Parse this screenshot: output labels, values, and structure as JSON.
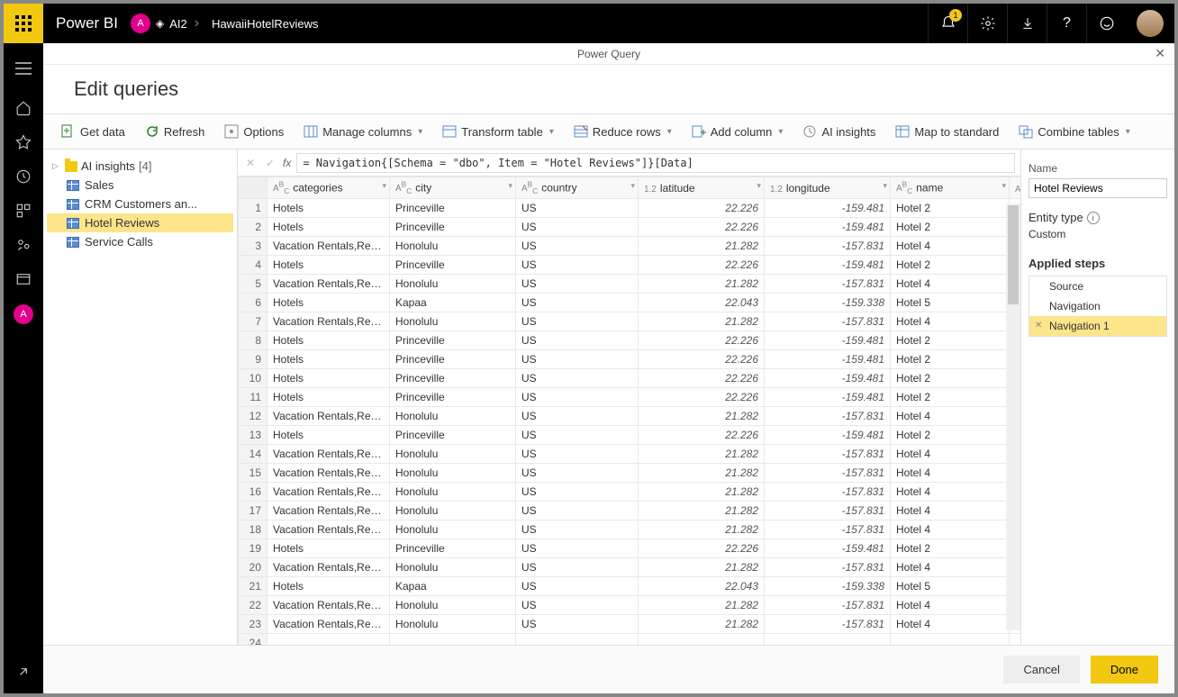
{
  "topbar": {
    "brand": "Power BI",
    "avatarLetter": "A",
    "workspace": "AI2",
    "breadcrumbItem": "HawaiiHotelReviews",
    "notificationCount": "1"
  },
  "pq": {
    "windowTitle": "Power Query",
    "pageTitle": "Edit queries"
  },
  "ribbon": {
    "getData": "Get data",
    "refresh": "Refresh",
    "options": "Options",
    "manageColumns": "Manage columns",
    "transformTable": "Transform table",
    "reduceRows": "Reduce rows",
    "addColumn": "Add column",
    "aiInsights": "AI insights",
    "mapStd": "Map to standard",
    "combineTables": "Combine tables"
  },
  "queriesPane": {
    "folder": "AI insights",
    "folderCount": "[4]",
    "items": [
      "Sales",
      "CRM Customers an...",
      "Hotel Reviews",
      "Service Calls"
    ],
    "selectedIndex": 2
  },
  "formulaBar": {
    "formula": "= Navigation{[Schema = \"dbo\", Item = \"Hotel Reviews\"]}[Data]"
  },
  "table": {
    "columns": [
      {
        "type": "ABC",
        "name": "categories"
      },
      {
        "type": "ABC",
        "name": "city"
      },
      {
        "type": "ABC",
        "name": "country"
      },
      {
        "type": "1.2",
        "name": "latitude"
      },
      {
        "type": "1.2",
        "name": "longitude"
      },
      {
        "type": "ABC",
        "name": "name"
      }
    ],
    "rows": [
      [
        "Hotels",
        "Princeville",
        "US",
        "22.226",
        "-159.481",
        "Hotel 2"
      ],
      [
        "Hotels",
        "Princeville",
        "US",
        "22.226",
        "-159.481",
        "Hotel 2"
      ],
      [
        "Vacation Rentals,Resorts &...",
        "Honolulu",
        "US",
        "21.282",
        "-157.831",
        "Hotel 4"
      ],
      [
        "Hotels",
        "Princeville",
        "US",
        "22.226",
        "-159.481",
        "Hotel 2"
      ],
      [
        "Vacation Rentals,Resorts &...",
        "Honolulu",
        "US",
        "21.282",
        "-157.831",
        "Hotel 4"
      ],
      [
        "Hotels",
        "Kapaa",
        "US",
        "22.043",
        "-159.338",
        "Hotel 5"
      ],
      [
        "Vacation Rentals,Resorts &...",
        "Honolulu",
        "US",
        "21.282",
        "-157.831",
        "Hotel 4"
      ],
      [
        "Hotels",
        "Princeville",
        "US",
        "22.226",
        "-159.481",
        "Hotel 2"
      ],
      [
        "Hotels",
        "Princeville",
        "US",
        "22.226",
        "-159.481",
        "Hotel 2"
      ],
      [
        "Hotels",
        "Princeville",
        "US",
        "22.226",
        "-159.481",
        "Hotel 2"
      ],
      [
        "Hotels",
        "Princeville",
        "US",
        "22.226",
        "-159.481",
        "Hotel 2"
      ],
      [
        "Vacation Rentals,Resorts &...",
        "Honolulu",
        "US",
        "21.282",
        "-157.831",
        "Hotel 4"
      ],
      [
        "Hotels",
        "Princeville",
        "US",
        "22.226",
        "-159.481",
        "Hotel 2"
      ],
      [
        "Vacation Rentals,Resorts &...",
        "Honolulu",
        "US",
        "21.282",
        "-157.831",
        "Hotel 4"
      ],
      [
        "Vacation Rentals,Resorts &...",
        "Honolulu",
        "US",
        "21.282",
        "-157.831",
        "Hotel 4"
      ],
      [
        "Vacation Rentals,Resorts &...",
        "Honolulu",
        "US",
        "21.282",
        "-157.831",
        "Hotel 4"
      ],
      [
        "Vacation Rentals,Resorts &...",
        "Honolulu",
        "US",
        "21.282",
        "-157.831",
        "Hotel 4"
      ],
      [
        "Vacation Rentals,Resorts &...",
        "Honolulu",
        "US",
        "21.282",
        "-157.831",
        "Hotel 4"
      ],
      [
        "Hotels",
        "Princeville",
        "US",
        "22.226",
        "-159.481",
        "Hotel 2"
      ],
      [
        "Vacation Rentals,Resorts &...",
        "Honolulu",
        "US",
        "21.282",
        "-157.831",
        "Hotel 4"
      ],
      [
        "Hotels",
        "Kapaa",
        "US",
        "22.043",
        "-159.338",
        "Hotel 5"
      ],
      [
        "Vacation Rentals,Resorts &...",
        "Honolulu",
        "US",
        "21.282",
        "-157.831",
        "Hotel 4"
      ],
      [
        "Vacation Rentals,Resorts &...",
        "Honolulu",
        "US",
        "21.282",
        "-157.831",
        "Hotel 4"
      ]
    ]
  },
  "rightPane": {
    "nameLabel": "Name",
    "nameValue": "Hotel Reviews",
    "entityTypeLabel": "Entity type",
    "entityTypeValue": "Custom",
    "appliedStepsLabel": "Applied steps",
    "steps": [
      "Source",
      "Navigation",
      "Navigation 1"
    ],
    "selectedStep": 2
  },
  "footer": {
    "cancel": "Cancel",
    "done": "Done"
  }
}
